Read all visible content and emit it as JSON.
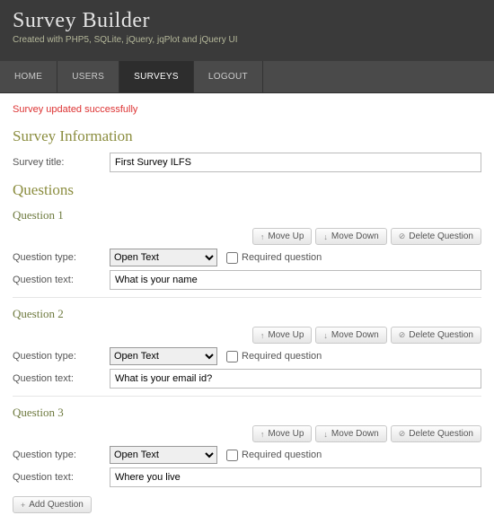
{
  "header": {
    "title": "Survey Builder",
    "subtitle": "Created with PHP5, SQLite, jQuery, jqPlot and jQuery UI"
  },
  "nav": {
    "items": [
      {
        "label": "HOME"
      },
      {
        "label": "USERS"
      },
      {
        "label": "SURVEYS"
      },
      {
        "label": "LOGOUT"
      }
    ],
    "active_index": 2
  },
  "message": "Survey updated successfully",
  "headings": {
    "survey_info": "Survey Information",
    "questions": "Questions"
  },
  "labels": {
    "survey_title": "Survey title:",
    "question_type": "Question type:",
    "question_text": "Question text:",
    "required": "Required question"
  },
  "survey": {
    "title_value": "First Survey ILFS"
  },
  "buttons": {
    "move_up": "Move Up",
    "move_down": "Move Down",
    "delete": "Delete Question",
    "add": "Add Question"
  },
  "icons": {
    "up": "↑",
    "down": "↓",
    "delete": "⊘",
    "add": "+"
  },
  "questions": [
    {
      "heading": "Question 1",
      "type": "Open Text",
      "text": "What is your name"
    },
    {
      "heading": "Question 2",
      "type": "Open Text",
      "text": "What is your email id?"
    },
    {
      "heading": "Question 3",
      "type": "Open Text",
      "text": "Where you live"
    }
  ]
}
